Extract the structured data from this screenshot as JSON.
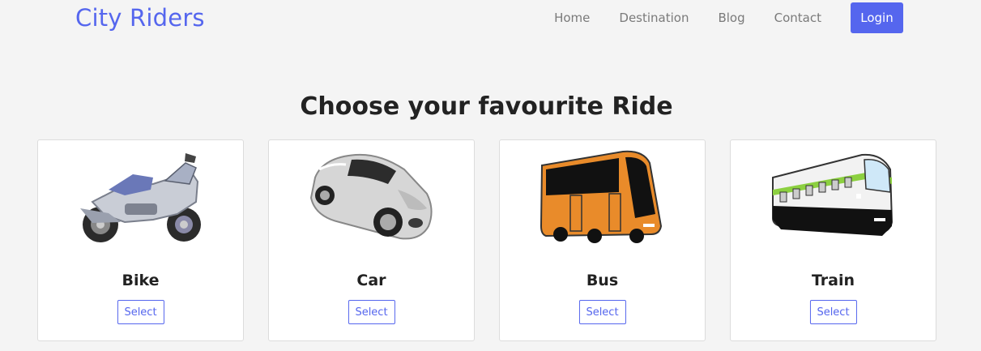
{
  "header": {
    "brand": "City Riders",
    "nav": [
      "Home",
      "Destination",
      "Blog",
      "Contact"
    ],
    "login_label": "Login"
  },
  "main": {
    "heading": "Choose your favourite Ride",
    "select_label": "Select",
    "rides": [
      {
        "name": "Bike",
        "icon": "motorcycle-image"
      },
      {
        "name": "Car",
        "icon": "car-image"
      },
      {
        "name": "Bus",
        "icon": "bus-image"
      },
      {
        "name": "Train",
        "icon": "train-image"
      }
    ]
  },
  "colors": {
    "accent": "#5566ee",
    "background": "#f4f4f4",
    "bus_body": "#e98b2a",
    "train_stripe": "#8cd040"
  }
}
